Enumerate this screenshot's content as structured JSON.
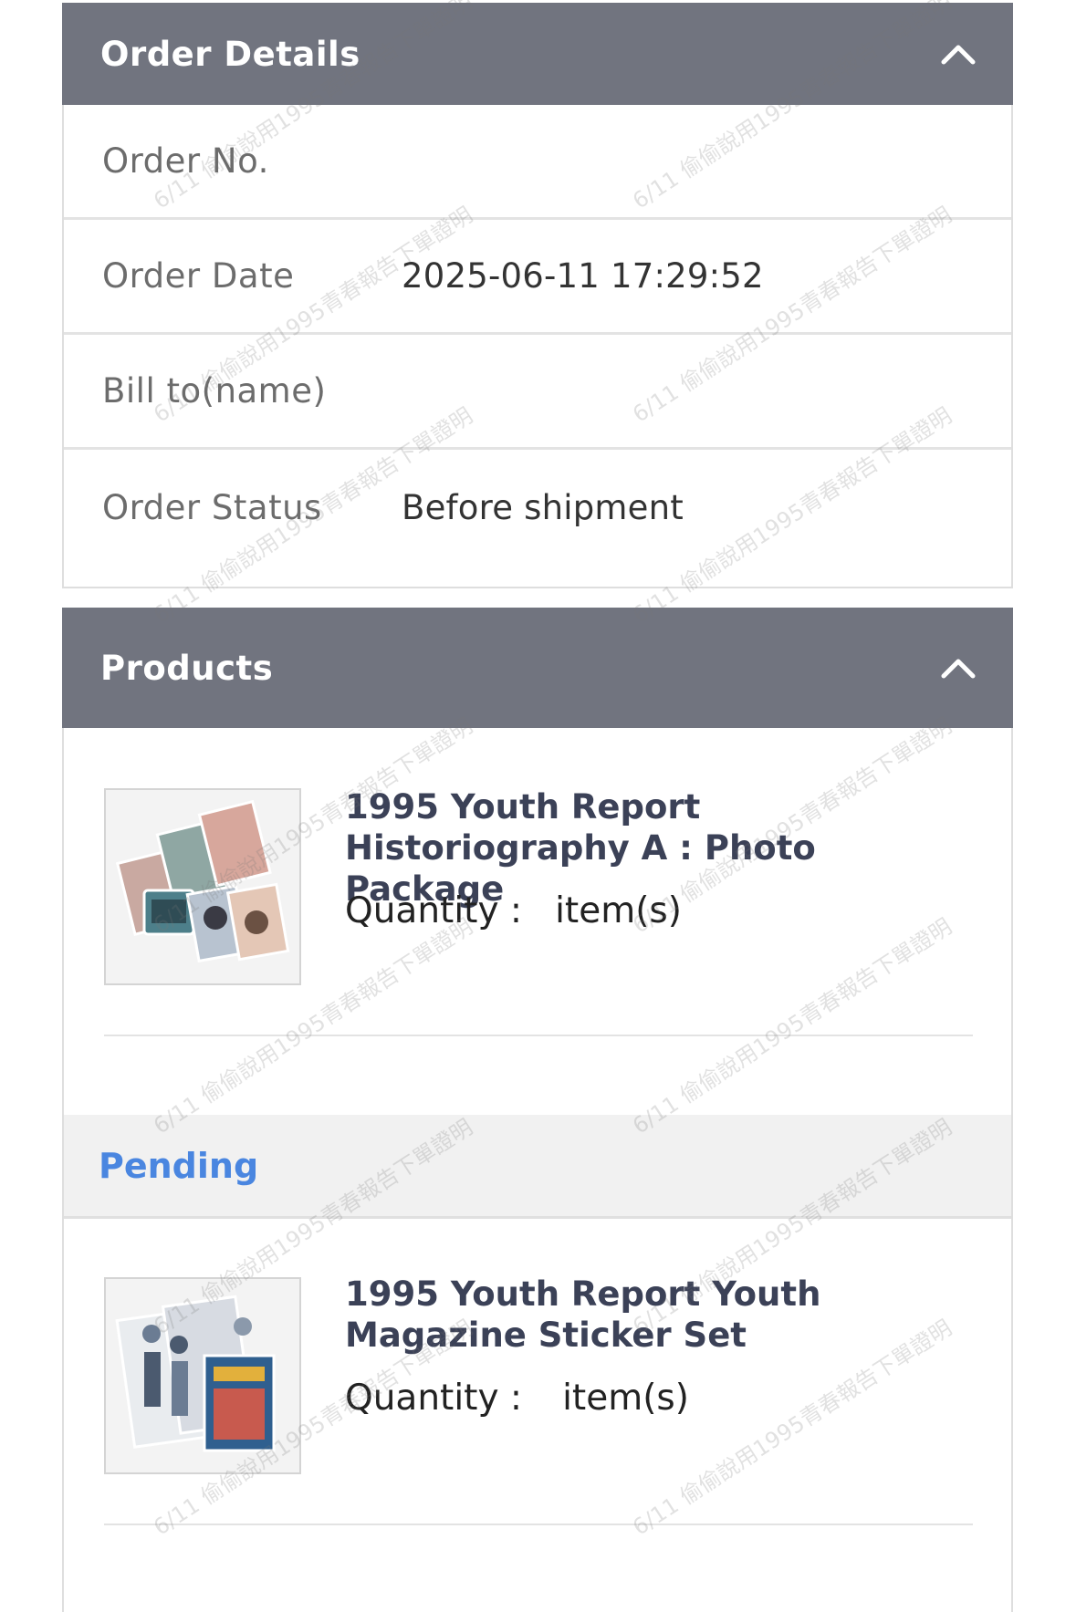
{
  "order_details": {
    "title": "Order Details",
    "collapse_icon": "chevron-up-icon",
    "rows": [
      {
        "label": "Order No.",
        "value": ""
      },
      {
        "label": "Order Date",
        "value": "2025-06-11 17:29:52"
      },
      {
        "label": "Bill to(name)",
        "value": ""
      },
      {
        "label": "Order Status",
        "value": "Before shipment"
      }
    ]
  },
  "products": {
    "title": "Products",
    "collapse_icon": "chevron-up-icon",
    "items": [
      {
        "name": "1995 Youth Report Historiography A : Photo Package",
        "quantity_label": "Quantity :",
        "quantity_unit": "item(s)"
      },
      {
        "name": "1995 Youth Report Youth Magazine Sticker Set",
        "quantity_label": "Quantity :",
        "quantity_unit": "item(s)"
      }
    ],
    "group_label": "Pending"
  },
  "watermark_text": "6/11 偷偷說用1995青春報告下單證明",
  "colors": {
    "header_bg": "#71747f",
    "pending_text": "#4a86e0",
    "product_name": "#3b4157"
  }
}
